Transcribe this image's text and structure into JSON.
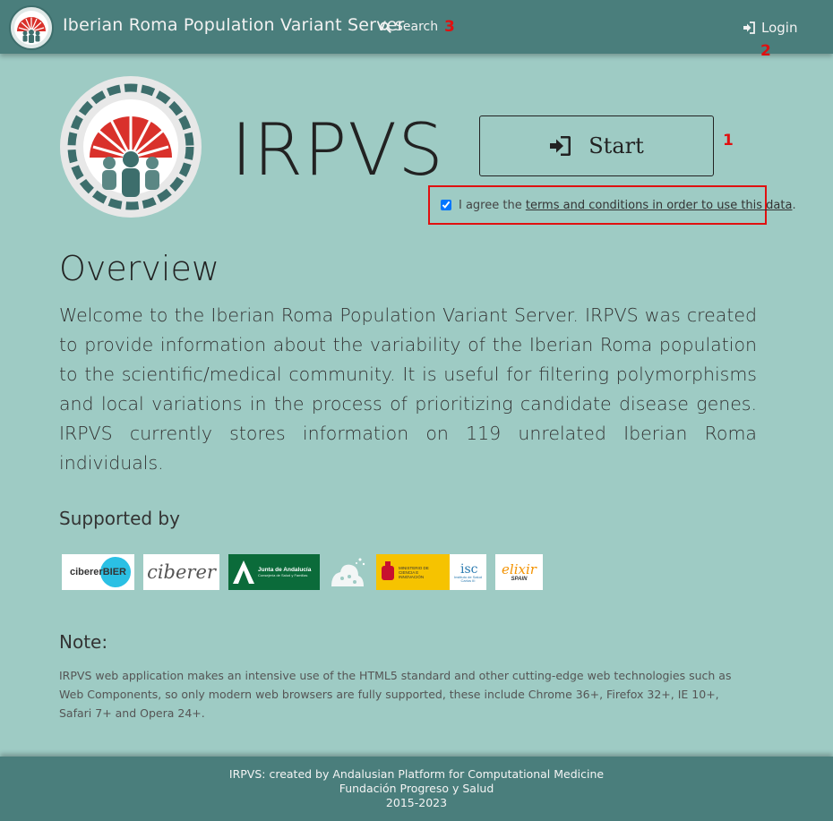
{
  "navbar": {
    "title": "Iberian Roma Population Variant Server",
    "search_label": "Search",
    "login_label": "Login",
    "logo_icon": "roma-wheel-logo-icon"
  },
  "annotations": {
    "one": "1",
    "two": "2",
    "three": "3"
  },
  "hero": {
    "brand": "IRPVS",
    "start_label": "Start",
    "terms_prefix": "I agree the ",
    "terms_link": "terms and conditions in order to use this data",
    "terms_suffix": ".",
    "terms_checked": true
  },
  "overview": {
    "title": "Overview",
    "text": "Welcome to the Iberian Roma Population Variant Server. IRPVS was created to provide information about the variability of the Iberian Roma population to the scientific/medical community. It is useful for filtering polymorphisms and local variations in the process of prioritizing candidate disease genes. IRPVS currently stores information on 119 unrelated Iberian Roma individuals."
  },
  "supported": {
    "title": "Supported by",
    "logos": {
      "ciberbier": "cibererBIER",
      "ciberer": "ciberer",
      "junta": "Junta de Andalucía",
      "junta_sub": "Consejería de Salud y Familias",
      "ministerio": "MINISTERIO DE CIENCIA E INNOVACIÓN",
      "isciii": "Instituto de Salud Carlos III",
      "elixir": "elixir",
      "elixir_sub": "SPAIN"
    }
  },
  "note": {
    "title": "Note:",
    "text": "IRPVS web application makes an intensive use of the HTML5 standard and other cutting-edge web technologies such as Web Components, so only modern web browsers are fully supported, these include Chrome 36+, Firefox 32+, IE 10+, Safari 7+ and Opera 24+."
  },
  "footer": {
    "line1": "IRPVS: created by Andalusian Platform for Computational Medicine",
    "line2": "Fundación Progreso y Salud",
    "line3": "2015-2023"
  },
  "colors": {
    "background": "#9ecbc4",
    "navbar": "#4a7e7c",
    "annotation": "#e01010",
    "logo_red": "#d9312b",
    "logo_teal": "#3d6e6c"
  }
}
